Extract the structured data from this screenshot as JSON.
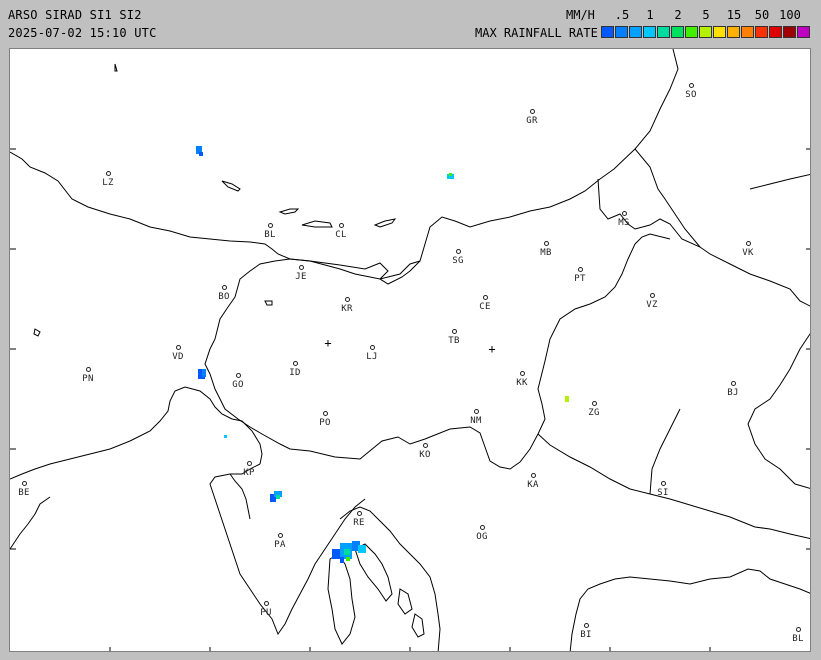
{
  "header": {
    "title": "ARSO SIRAD SI1 SI2",
    "timestamp": "2025-07-02 15:10 UTC",
    "units": "MM/H",
    "legend_label": "MAX RAINFALL RATE"
  },
  "legend": {
    "scale_labels": [
      ".5",
      "1",
      "2",
      "5",
      "15",
      "50",
      "100"
    ],
    "colors": [
      "#0058ff",
      "#0080ff",
      "#00a0ff",
      "#00c8ff",
      "#00dca0",
      "#00e060",
      "#40f000",
      "#b4f000",
      "#ffe000",
      "#ffb000",
      "#ff8000",
      "#ff3000",
      "#e00000",
      "#a00000",
      "#c000c0"
    ]
  },
  "map": {
    "cities": [
      {
        "code": "SO"
      },
      {
        "code": "GR"
      },
      {
        "code": "LZ"
      },
      {
        "code": "BL"
      },
      {
        "code": "CL"
      },
      {
        "code": "MB"
      },
      {
        "code": "MS"
      },
      {
        "code": "VK"
      },
      {
        "code": "SG"
      },
      {
        "code": "PT"
      },
      {
        "code": "JE"
      },
      {
        "code": "BO"
      },
      {
        "code": "KR"
      },
      {
        "code": "CE"
      },
      {
        "code": "VZ"
      },
      {
        "code": "TB"
      },
      {
        "code": "VD"
      },
      {
        "code": "LJ"
      },
      {
        "code": "PN"
      },
      {
        "code": "ID"
      },
      {
        "code": "GO"
      },
      {
        "code": "KK"
      },
      {
        "code": "BJ"
      },
      {
        "code": "ZG"
      },
      {
        "code": "PO"
      },
      {
        "code": "NM"
      },
      {
        "code": "KO"
      },
      {
        "code": "KP"
      },
      {
        "code": "KA"
      },
      {
        "code": "BE"
      },
      {
        "code": "SI"
      },
      {
        "code": "RE"
      },
      {
        "code": "PA"
      },
      {
        "code": "OG"
      },
      {
        "code": "PU"
      },
      {
        "code": "BI"
      },
      {
        "code": "BL"
      }
    ]
  }
}
